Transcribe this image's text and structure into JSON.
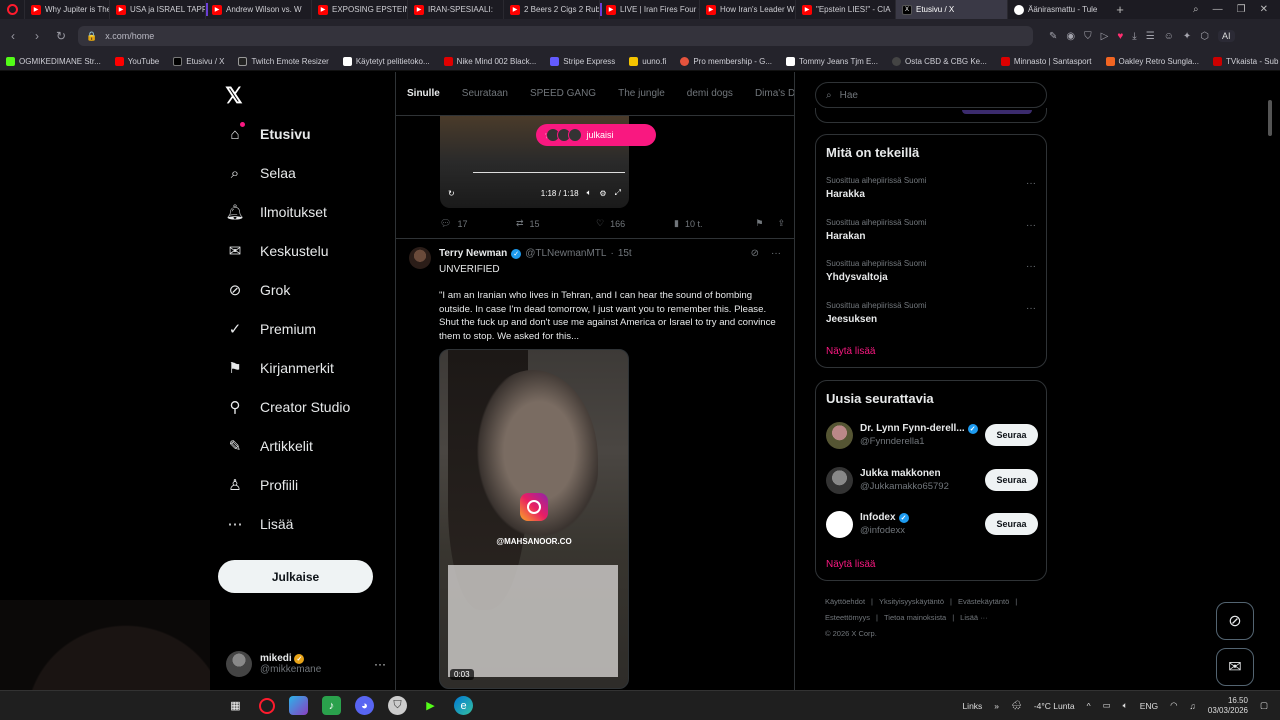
{
  "browser": {
    "tabs": [
      {
        "title": "Why Jupiter is The Sc",
        "icon": "youtube-icon"
      },
      {
        "title": "USA ja ISRAEL TAPPO",
        "icon": "youtube-icon"
      },
      {
        "title": "Andrew Wilson vs. W",
        "icon": "youtube-icon"
      },
      {
        "title": "EXPOSING EPSTEIN'S",
        "icon": "youtube-icon"
      },
      {
        "title": "IRAN-SPESIAALI:",
        "icon": "youtube-icon"
      },
      {
        "title": "2 Beers 2 Cigs 2 Rubik",
        "icon": "youtube-icon"
      },
      {
        "title": "LIVE | Iran Fires Four C",
        "icon": "youtube-icon"
      },
      {
        "title": "How Iran's Leader W",
        "icon": "youtube-icon"
      },
      {
        "title": "\"Epstein LIES!\" - CIA",
        "icon": "youtube-icon"
      },
      {
        "title": "Etusivu / X",
        "icon": "x-icon"
      },
      {
        "title": "Äänirasmattu - Tule",
        "icon": "web-icon"
      }
    ],
    "url": "x.com/home",
    "ai_label": "AI",
    "bookmarks": [
      "OGMIKEDIMANE Str...",
      "YouTube",
      "Etusivu / X",
      "Twitch Emote Resizer",
      "Käytetyt pelitietoko...",
      "Nike Mind 002 Black...",
      "Stripe Express",
      "uuno.fi",
      "Pro membership - G...",
      "Tommy Jeans Tjm E...",
      "Osta CBD & CBG Ke...",
      "Minnasto | Santasport",
      "Oakley Retro Sungla...",
      "TVkaista - Sub Suara"
    ]
  },
  "nav": {
    "items": [
      "Etusivu",
      "Selaa",
      "Ilmoitukset",
      "Keskustelu",
      "Grok",
      "Premium",
      "Kirjanmerkit",
      "Creator Studio",
      "Artikkelit",
      "Profiili",
      "Lisää"
    ],
    "post_label": "Julkaise",
    "account_name": "mikedi",
    "account_handle": "@mikkemane"
  },
  "feed": {
    "tabs": [
      "Sinulle",
      "Seurataan",
      "SPEED GANG",
      "The jungle",
      "demi dogs",
      "Dima's Dist"
    ],
    "new_posts_label": "julkaisi",
    "video1": {
      "time": "1:18 / 1:18"
    },
    "tweet1_stats": {
      "replies": "17",
      "reposts": "15",
      "likes": "166",
      "views": "10 t."
    },
    "tweet2": {
      "name": "Terry Newman",
      "handle": "@TLNewmanMTL",
      "time": "15t",
      "label": "UNVERIFIED",
      "text": "\"I am an Iranian who lives in Tehran, and I can hear the sound of bombing outside. In case I'm dead tomorrow, I just want you to remember this. Please. Shut the fuck up and don't use me against America or Israel to try and convince them to stop. We asked for this...",
      "video_tag": "@MAHSANOOR.CO",
      "video_duration": "0:03"
    }
  },
  "right": {
    "search_placeholder": "Hae",
    "trends_title": "Mitä on tekeillä",
    "trends": [
      {
        "context": "Suosittua aihepiirissä Suomi",
        "title": "Harakka"
      },
      {
        "context": "Suosittua aihepiirissä Suomi",
        "title": "Harakan"
      },
      {
        "context": "Suosittua aihepiirissä Suomi",
        "title": "Yhdysvaltoja"
      },
      {
        "context": "Suosittua aihepiirissä Suomi",
        "title": "Jeesuksen"
      }
    ],
    "show_more": "Näytä lisää",
    "who_title": "Uusia seurattavia",
    "who": [
      {
        "name": "Dr. Lynn Fynn-derell...",
        "handle": "@Fynnderella1",
        "verified": true
      },
      {
        "name": "Jukka makkonen",
        "handle": "@Jukkamakko65792",
        "verified": false
      },
      {
        "name": "Infodex",
        "handle": "@infodexx",
        "verified": true
      }
    ],
    "follow_label": "Seuraa",
    "footer_links": [
      "Käyttöehdot",
      "|",
      "Yksityisyyskäytäntö",
      "|",
      "Evästekäytäntö",
      "|",
      "Esteettömyys",
      "|",
      "Tietoa mainoksista",
      "|",
      "Lisää ···"
    ],
    "copyright": "© 2026 X Corp."
  },
  "taskbar": {
    "links": "Links",
    "weather": "-4°C  Lunta",
    "lang": "ENG",
    "time": "16.50",
    "date": "03/03/2026"
  },
  "colors": {
    "accent": "#f91880",
    "verified": "#1d9bf0",
    "bg": "#000000"
  }
}
